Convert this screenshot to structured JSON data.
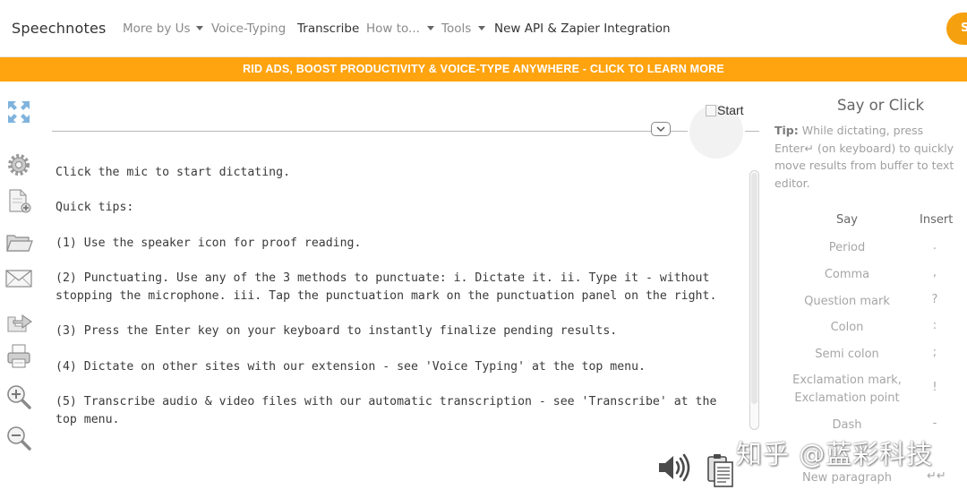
{
  "navbar": {
    "brand": "Speechnotes",
    "items": [
      {
        "label": "More by Us",
        "dropdown": true
      },
      {
        "label": "Voice-Typing",
        "dropdown": false
      },
      {
        "label": "Transcribe",
        "dropdown": false
      },
      {
        "label": "How to...",
        "dropdown": true
      },
      {
        "label": "Tools",
        "dropdown": true
      },
      {
        "label": "New API & Zapier Integration",
        "dropdown": false
      }
    ],
    "signin_initial": "S"
  },
  "promo": {
    "text": "RID ADS, BOOST PRODUCTIVITY & VOICE-TYPE ANYWHERE - CLICK TO LEARN MORE"
  },
  "toolbar": {
    "icons": [
      "fullscreen-icon",
      "settings-gear-icon",
      "new-document-icon",
      "open-folder-icon",
      "email-icon",
      "export-icon",
      "print-icon",
      "zoom-in-icon",
      "zoom-out-icon"
    ]
  },
  "editor": {
    "start_alt": "Start",
    "lines": [
      "Click the mic to start dictating.",
      "Quick tips:",
      "(1) Use the speaker icon for proof reading.",
      "(2) Punctuating. Use any of the 3 methods to punctuate: i. Dictate it. ii. Type it - without stopping the microphone. iii. Tap the punctuation mark on the punctuation panel on the right.",
      "(3) Press the Enter key on your keyboard to instantly finalize pending results.",
      "(4) Dictate on other sites with our extension - see 'Voice Typing' at the top menu.",
      "(5) Transcribe audio & video files with our automatic transcription - see 'Transcribe' at the top menu."
    ]
  },
  "panel": {
    "title": "Say or Click",
    "tip_label": "Tip:",
    "tip_text": "While dictating, press Enter↵ (on keyboard) to quickly move results from buffer to text editor.",
    "col_say": "Say",
    "col_insert": "Insert",
    "rows": [
      {
        "say": "Period",
        "insert": "."
      },
      {
        "say": "Comma",
        "insert": ","
      },
      {
        "say": "Question mark",
        "insert": "?"
      },
      {
        "say": "Colon",
        "insert": ":"
      },
      {
        "say": "Semi colon",
        "insert": ";"
      },
      {
        "say": "Exclamation mark, Exclamation point",
        "insert": "!"
      },
      {
        "say": "Dash",
        "insert": "-"
      },
      {
        "say": "New paragraph",
        "insert": "↵↵"
      }
    ]
  },
  "watermark": {
    "text": "知乎 @蓝彩科技"
  },
  "colors": {
    "accent": "#ffa30f",
    "signin": "#f5a00f",
    "icon_blue": "#6aa6d6"
  }
}
